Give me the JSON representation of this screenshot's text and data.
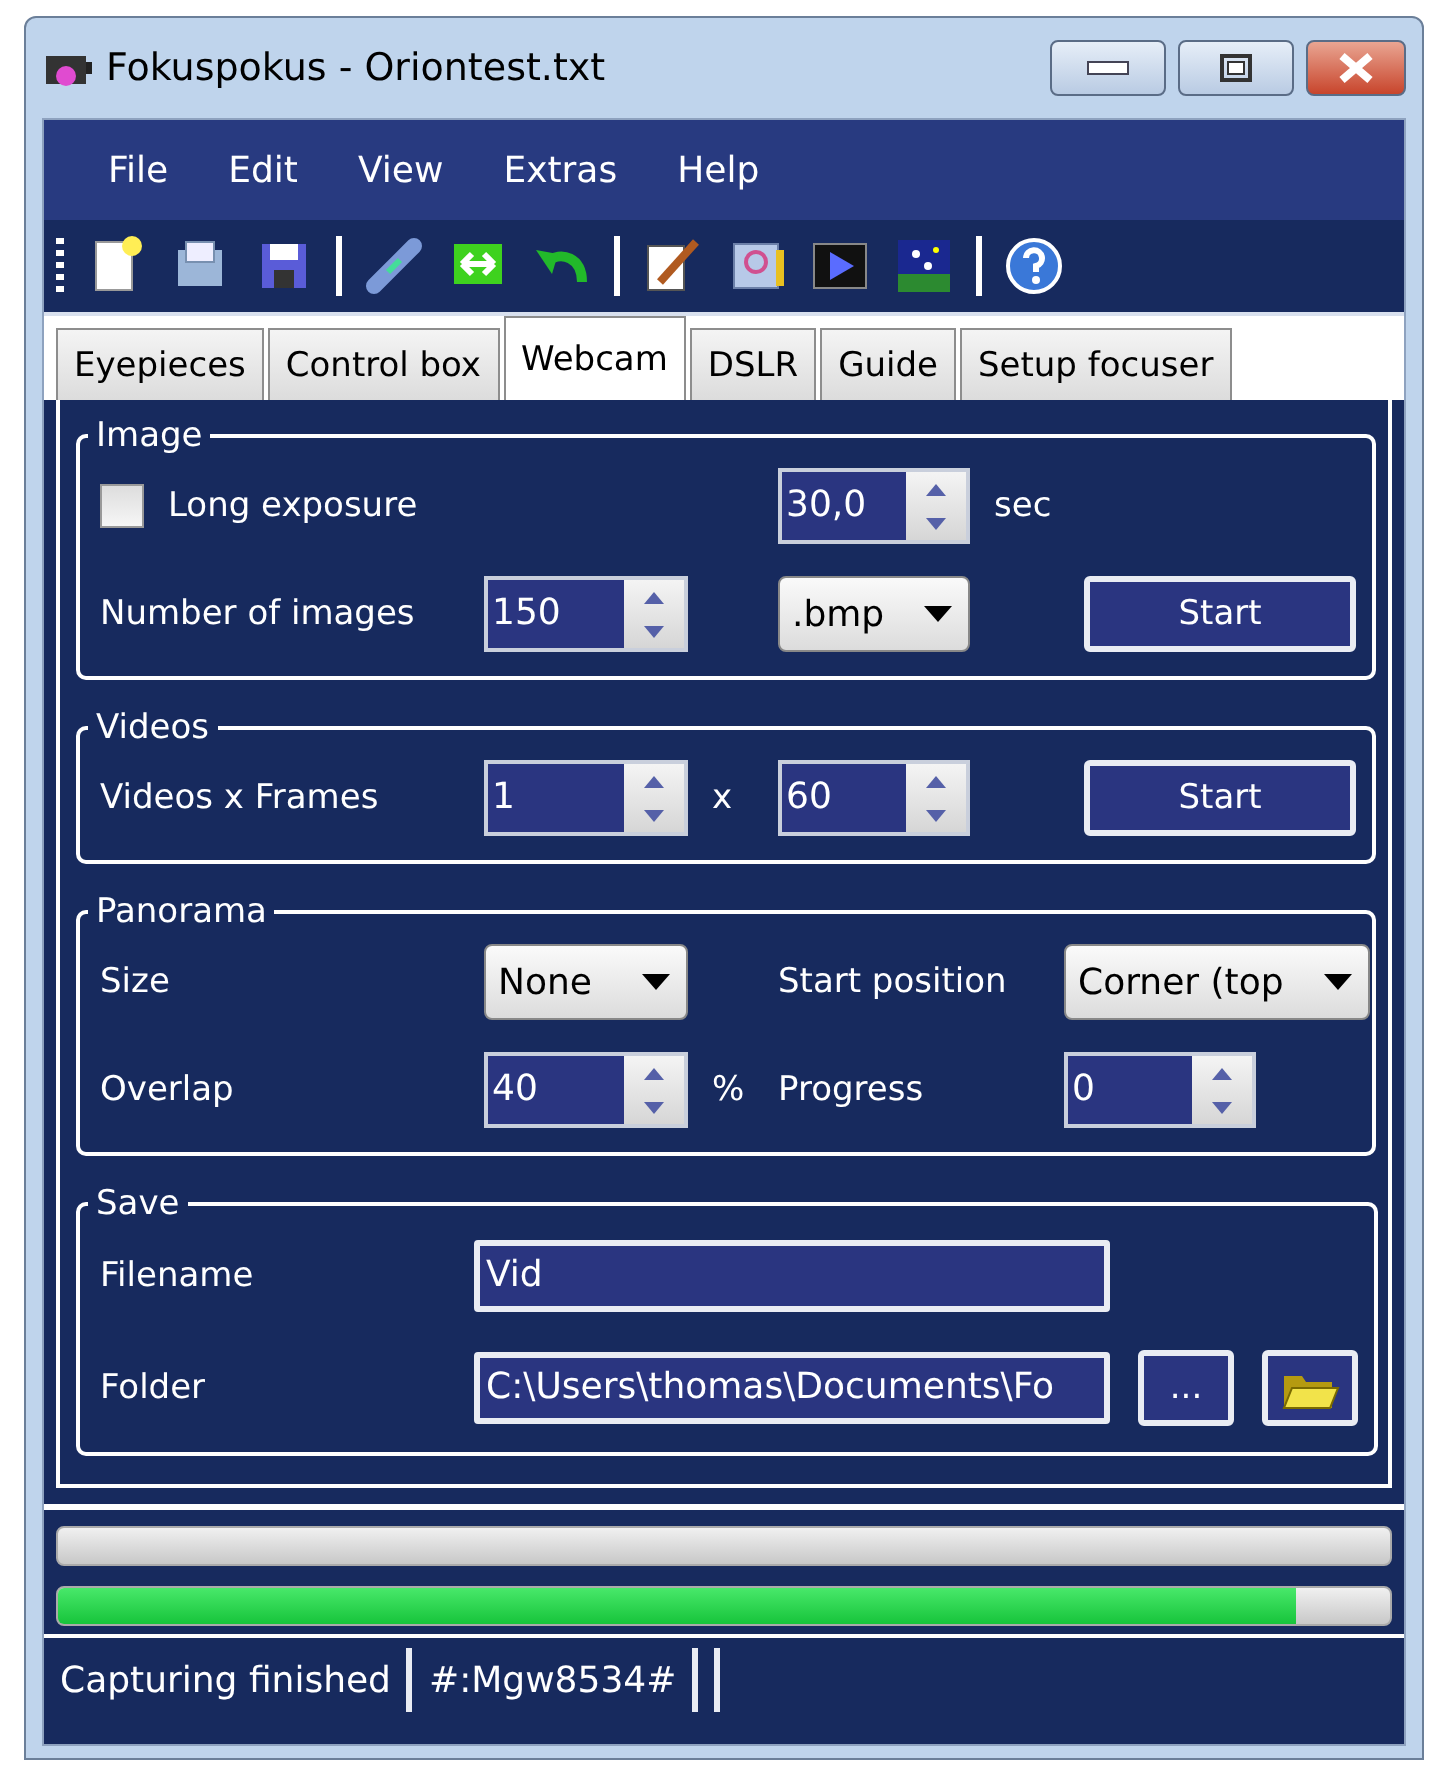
{
  "window": {
    "title": "Fokuspokus - Oriontest.txt"
  },
  "menu": [
    "File",
    "Edit",
    "View",
    "Extras",
    "Help"
  ],
  "tabs": [
    {
      "label": "Eyepieces",
      "selected": false
    },
    {
      "label": "Control box",
      "selected": false
    },
    {
      "label": "Webcam",
      "selected": true
    },
    {
      "label": "DSLR",
      "selected": false
    },
    {
      "label": "Guide",
      "selected": false
    },
    {
      "label": "Setup focuser",
      "selected": false
    }
  ],
  "image": {
    "title": "Image",
    "long_exposure": {
      "label": "Long exposure",
      "checked": false
    },
    "exposure": {
      "value": "30,0",
      "unit": "sec"
    },
    "number_label": "Number of images",
    "number": "150",
    "format": ".bmp",
    "start": "Start"
  },
  "videos": {
    "title": "Videos",
    "label": "Videos x Frames",
    "videos": "1",
    "times": "x",
    "frames": "60",
    "start": "Start"
  },
  "panorama": {
    "title": "Panorama",
    "size_label": "Size",
    "size": "None",
    "start_label": "Start position",
    "start_position": "Corner (top",
    "overlap_label": "Overlap",
    "overlap": "40",
    "percent": "%",
    "progress_label": "Progress",
    "progress": "0"
  },
  "save": {
    "title": "Save",
    "filename_label": "Filename",
    "filename": "Vid",
    "folder_label": "Folder",
    "folder": "C:\\Users\\thomas\\Documents\\Fo",
    "browse": "..."
  },
  "progress_bars": [
    {
      "kind": "empty"
    },
    {
      "kind": "filled",
      "level": 0.93
    }
  ],
  "status_bar": [
    "Capturing finished",
    "#:Mgw8534#"
  ]
}
